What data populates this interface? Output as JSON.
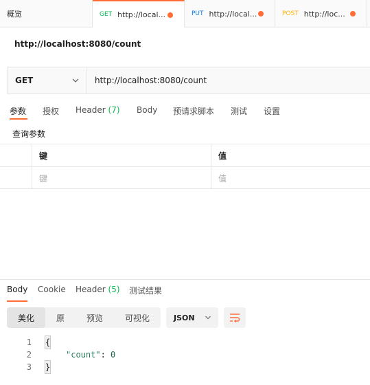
{
  "tabs": {
    "overview": "概览",
    "items": [
      {
        "method": "GET",
        "url": "http://local..."
      },
      {
        "method": "PUT",
        "url": "http://local..."
      },
      {
        "method": "POST",
        "url": "http://loc..."
      }
    ]
  },
  "request": {
    "title": "http://localhost:8080/count",
    "method": "GET",
    "url": "http://localhost:8080/count"
  },
  "request_tabs": {
    "params": "参数",
    "auth": "授权",
    "header": "Header",
    "header_count": "(7)",
    "body": "Body",
    "prerequest": "预请求脚本",
    "tests": "测试",
    "settings": "设置"
  },
  "query_params": {
    "label": "查询参数",
    "col_key": "键",
    "col_value": "值",
    "key_placeholder": "键",
    "value_placeholder": "值"
  },
  "response": {
    "tabs": {
      "body": "Body",
      "cookie": "Cookie",
      "header": "Header",
      "header_count": "(5)",
      "test_results": "测试结果"
    },
    "view_modes": [
      "美化",
      "原",
      "预览",
      "可视化"
    ],
    "format": "JSON",
    "code_lines": [
      {
        "n": "1",
        "text": "{"
      },
      {
        "n": "2",
        "key": "\"count\"",
        "sep": ": ",
        "value": "0"
      },
      {
        "n": "3",
        "text": "}"
      }
    ]
  },
  "colors": {
    "accent": "#ff6c37",
    "get": "#0cbb52",
    "put": "#097bed",
    "post": "#ffb400"
  }
}
